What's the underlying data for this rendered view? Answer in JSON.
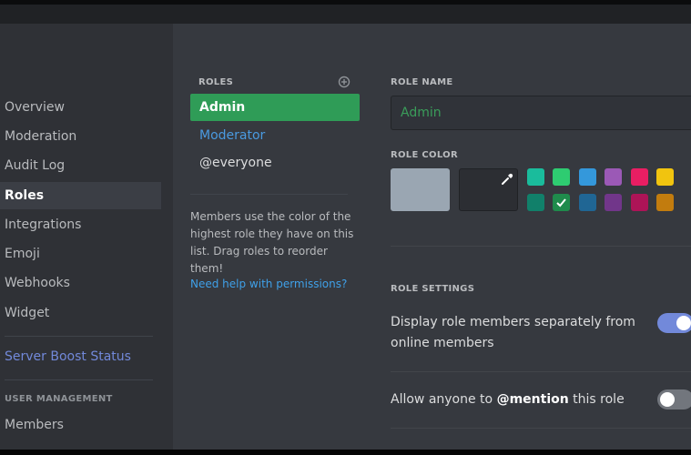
{
  "sidebar": {
    "items": [
      {
        "label": "Overview"
      },
      {
        "label": "Moderation"
      },
      {
        "label": "Audit Log"
      },
      {
        "label": "Roles"
      },
      {
        "label": "Integrations"
      },
      {
        "label": "Emoji"
      },
      {
        "label": "Webhooks"
      },
      {
        "label": "Widget"
      }
    ],
    "selected": "Roles",
    "boost_label": "Server Boost Status",
    "user_management_header": "USER MANAGEMENT",
    "members_label": "Members"
  },
  "roles": {
    "header": "ROLES",
    "items": [
      {
        "name": "Admin",
        "color": "#2f9c57"
      },
      {
        "name": "Moderator",
        "color": "#4a9ae0"
      },
      {
        "name": "@everyone",
        "color": "#dcddde"
      }
    ],
    "selected": "Admin",
    "help_text": "Members use the color of the highest role they have on this list. Drag roles to reorder them!",
    "help_link": "Need help with permissions?",
    "add_icon": "plus-circle-icon"
  },
  "role_name": {
    "label": "ROLE NAME",
    "value": "Admin"
  },
  "role_color": {
    "label": "ROLE COLOR",
    "default_color": "#9aa6b2",
    "picker_icon": "eyedropper-icon",
    "swatches_top": [
      "#1abc9c",
      "#2ecc71",
      "#3498db",
      "#9b59b6",
      "#e91e63",
      "#f1c40f"
    ],
    "swatches_bottom": [
      "#11806a",
      "#1f8b4c",
      "#206694",
      "#71368a",
      "#ad1457",
      "#c27c0e"
    ],
    "selected_swatch": "#1f8b4c"
  },
  "role_settings": {
    "label": "ROLE SETTINGS",
    "display_separately": {
      "text": "Display role members separately from online members",
      "enabled": true
    },
    "allow_mention": {
      "text_before": "Allow anyone to ",
      "text_bold": "@mention",
      "text_after": " this role",
      "enabled": false
    }
  }
}
